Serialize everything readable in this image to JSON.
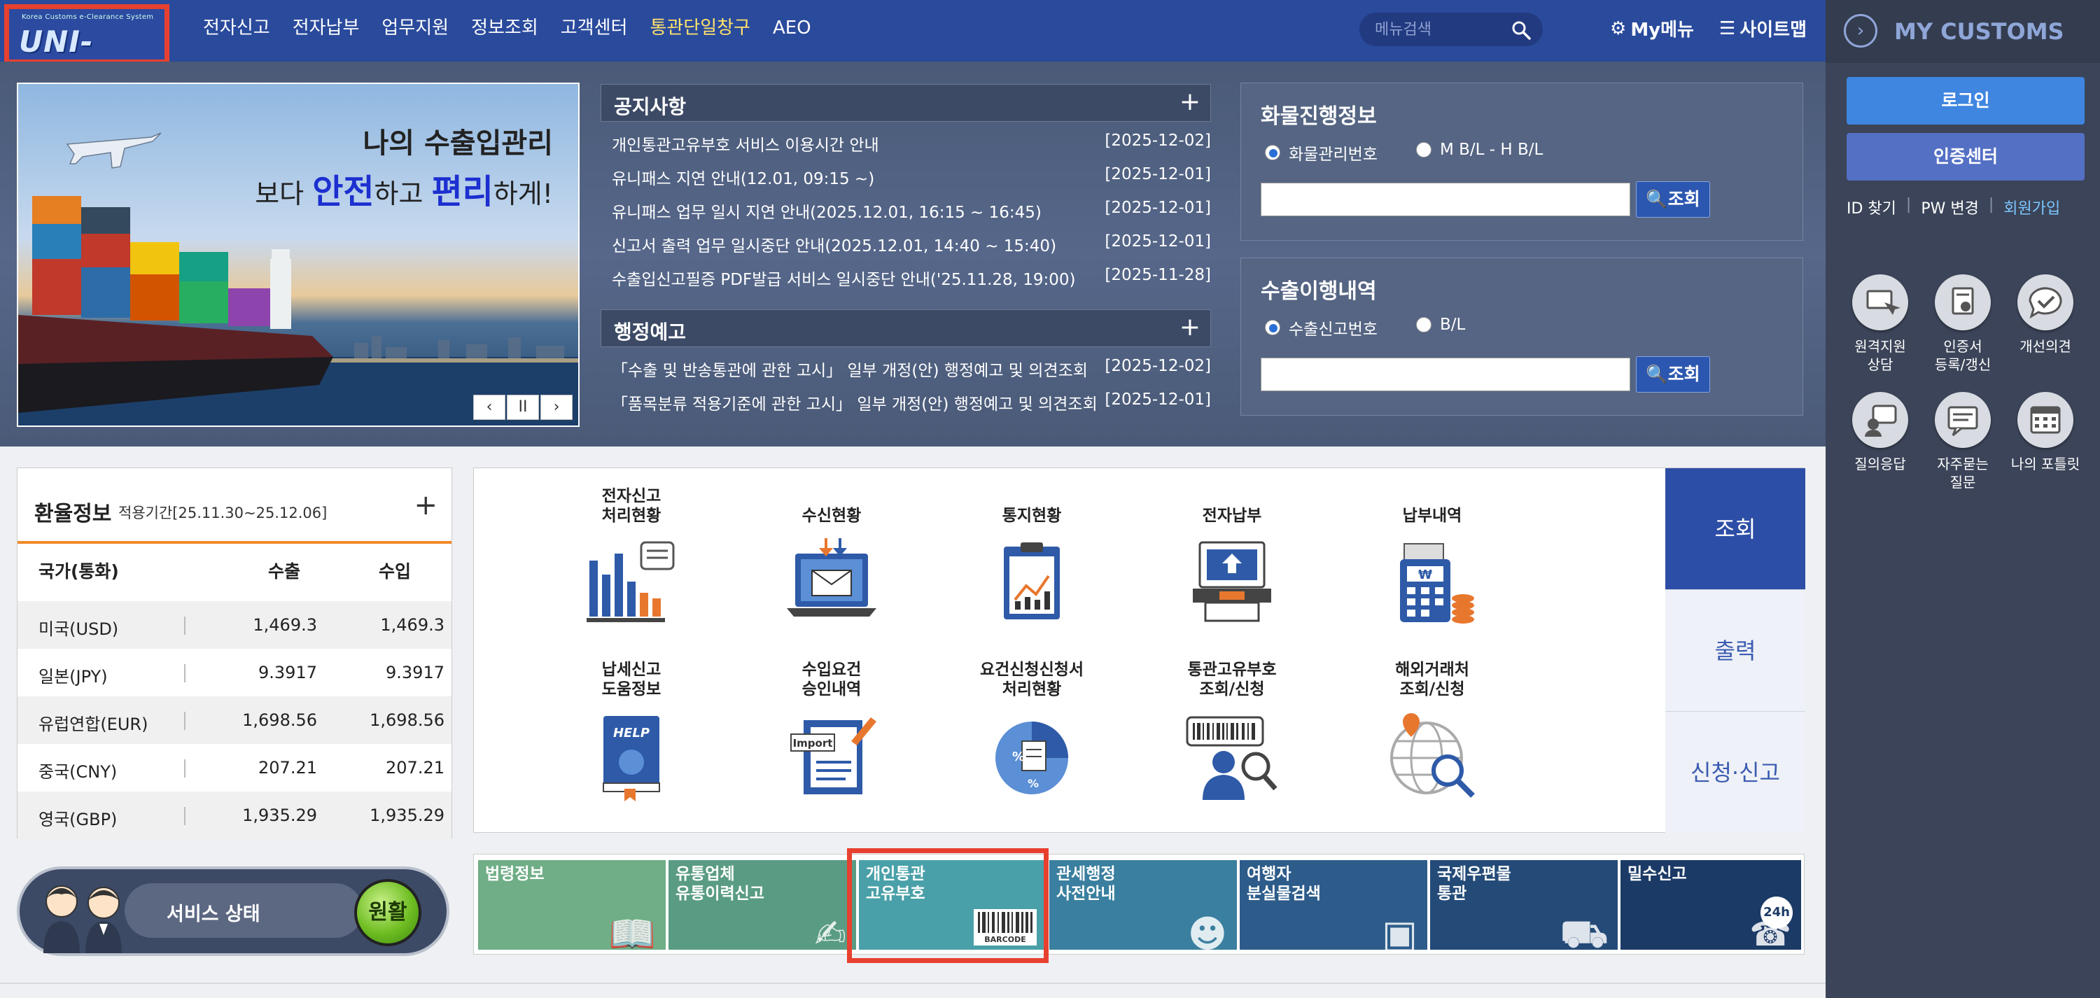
{
  "header": {
    "logo_sub": "Korea Customs e-Clearance System",
    "logo_text": "UNI-PASS",
    "nav": [
      "전자신고",
      "전자납부",
      "업무지원",
      "정보조회",
      "고객센터",
      "통관단일창구",
      "AEO"
    ],
    "search_placeholder": "메뉴검색",
    "my_menu": "My메뉴",
    "sitemap": "사이트맵"
  },
  "right_panel": {
    "title": "MY CUSTOMS",
    "login": "로그인",
    "cert_center": "인증센터",
    "links": {
      "find_id": "ID 찾기",
      "sep": "|",
      "pw_change": "PW 변경",
      "join": "회원가입"
    },
    "icons": [
      {
        "label": "원격지원\n상담"
      },
      {
        "label": "인증서\n등록/갱신"
      },
      {
        "label": "개선의견"
      },
      {
        "label": "질의응답"
      },
      {
        "label": "자주묻는\n질문"
      },
      {
        "label": "나의 포틀릿"
      }
    ]
  },
  "banner": {
    "line1": "나의 수출입관리",
    "line2_a": "보다 ",
    "line2_b": "안전",
    "line2_c": "하고 ",
    "line2_d": "편리",
    "line2_e": "하게!",
    "controls": [
      "‹",
      "II",
      "›"
    ]
  },
  "notices": {
    "title": "공지사항",
    "plus": "+",
    "items": [
      {
        "text": "개인통관고유부호 서비스 이용시간 안내",
        "date": "[2025-12-02]"
      },
      {
        "text": "유니패스 지연 안내(12.01, 09:15 ~)",
        "date": "[2025-12-01]"
      },
      {
        "text": "유니패스 업무 일시 지연 안내(2025.12.01, 16:15 ~ 16:45)",
        "date": "[2025-12-01]"
      },
      {
        "text": "신고서 출력 업무 일시중단 안내(2025.12.01, 14:40 ~ 15:40)",
        "date": "[2025-12-01]"
      },
      {
        "text": "수출입신고필증 PDF발급 서비스 일시중단 안내('25.11.28, 19:00)",
        "date": "[2025-11-28]"
      }
    ]
  },
  "admin_notices": {
    "title": "행정예고",
    "plus": "+",
    "items": [
      {
        "text": "「수출 및 반송통관에 관한 고시」 일부 개정(안) 행정예고 및 의견조회",
        "date": "[2025-12-02]"
      },
      {
        "text": "「품목분류 적용기준에 관한 고시」 일부 개정(안) 행정예고 및 의견조회",
        "date": "[2025-12-01]"
      }
    ]
  },
  "cargo": {
    "title": "화물진행정보",
    "option1": "화물관리번호",
    "option2": "M B/L - H B/L",
    "button": "조회"
  },
  "export": {
    "title": "수출이행내역",
    "option1": "수출신고번호",
    "option2": "B/L",
    "button": "조회"
  },
  "exchange": {
    "title": "환율정보",
    "period": "적용기간[25.11.30~25.12.06]",
    "plus": "+",
    "headers": {
      "currency": "국가(통화)",
      "export": "수출",
      "import": "수입"
    },
    "rows": [
      {
        "currency": "미국(USD)",
        "export": "1,469.3",
        "import": "1,469.3"
      },
      {
        "currency": "일본(JPY)",
        "export": "9.3917",
        "import": "9.3917"
      },
      {
        "currency": "유럽연합(EUR)",
        "export": "1,698.56",
        "import": "1,698.56"
      },
      {
        "currency": "중국(CNY)",
        "export": "207.21",
        "import": "207.21"
      },
      {
        "currency": "영국(GBP)",
        "export": "1,935.29",
        "import": "1,935.29"
      }
    ]
  },
  "service_status": {
    "label": "서비스 상태",
    "status": "원활"
  },
  "quick_menu": {
    "items": [
      {
        "label": "전자신고\n처리현황"
      },
      {
        "label": "수신현황"
      },
      {
        "label": "통지현황"
      },
      {
        "label": "전자납부"
      },
      {
        "label": "납부내역"
      },
      {
        "label": "납세신고\n도움정보"
      },
      {
        "label": "수입요건\n승인내역"
      },
      {
        "label": "요건신청신청서\n처리현황"
      },
      {
        "label": "통관고유부호\n조회/신청"
      },
      {
        "label": "해외거래처\n조회/신청"
      }
    ],
    "icon_text": {
      "help": "HELP",
      "import": "Import",
      "percent": "%"
    },
    "tabs": [
      "조회",
      "출력",
      "신청·신고"
    ]
  },
  "tiles": [
    {
      "label": "법령정보",
      "color": "#6fae86"
    },
    {
      "label": "유통업체\n유통이력신고",
      "color": "#5a9c83"
    },
    {
      "label": "개인통관\n고유부호",
      "color": "#4aa0a8",
      "icon_text": "BARCODE"
    },
    {
      "label": "관세행정\n사전안내",
      "color": "#3a7f9f"
    },
    {
      "label": "여행자\n분실물검색",
      "color": "#2d5c8a"
    },
    {
      "label": "국제우편물\n통관",
      "color": "#244b78"
    },
    {
      "label": "밀수신고",
      "color": "#1b3a66",
      "icon_text": "24h"
    }
  ]
}
